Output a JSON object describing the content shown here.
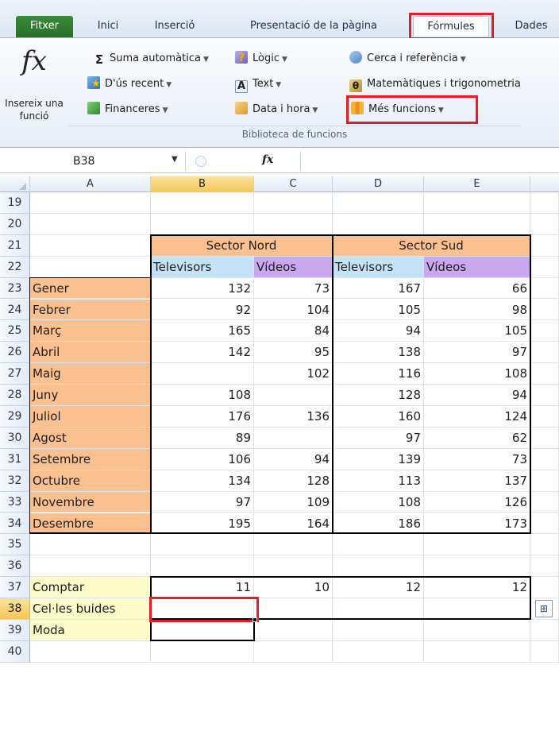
{
  "tabs": [
    "Fitxer",
    "Inici",
    "Inserció",
    "Presentació de la pàgina",
    "Fórmules",
    "Dades"
  ],
  "ribbon": {
    "insert_function": "Insereix una funció",
    "autosum": "Suma automàtica",
    "recent": "D'ús recent",
    "financial": "Financeres",
    "logical": "Lògic",
    "text": "Text",
    "datetime": "Data i hora",
    "lookup": "Cerca i referència",
    "math": "Matemàtiques i trigonometria",
    "more": "Més funcions",
    "group_label": "Biblioteca de funcions",
    "fx_symbol": "fx"
  },
  "formula_bar": {
    "name_box": "B38",
    "fx_symbol": "fx",
    "value": ""
  },
  "columns": [
    "A",
    "B",
    "C",
    "D",
    "E"
  ],
  "selected_column": "B",
  "selected_row": 38,
  "table": {
    "sector_nord": "Sector Nord",
    "sector_sud": "Sector Sud",
    "subheaders": [
      "Televisors",
      "Vídeos",
      "Televisors",
      "Vídeos"
    ],
    "months": [
      {
        "name": "Gener",
        "values": [
          "132",
          "73",
          "167",
          "66"
        ]
      },
      {
        "name": "Febrer",
        "values": [
          "92",
          "104",
          "105",
          "98"
        ]
      },
      {
        "name": "Març",
        "values": [
          "165",
          "84",
          "94",
          "105"
        ]
      },
      {
        "name": "Abril",
        "values": [
          "142",
          "95",
          "138",
          "97"
        ]
      },
      {
        "name": "Maig",
        "values": [
          "",
          "102",
          "116",
          "108"
        ]
      },
      {
        "name": "Juny",
        "values": [
          "108",
          "",
          "128",
          "94"
        ]
      },
      {
        "name": "Juliol",
        "values": [
          "176",
          "136",
          "160",
          "124"
        ]
      },
      {
        "name": "Agost",
        "values": [
          "89",
          "",
          "97",
          "62"
        ]
      },
      {
        "name": "Setembre",
        "values": [
          "106",
          "94",
          "139",
          "73"
        ]
      },
      {
        "name": "Octubre",
        "values": [
          "134",
          "128",
          "113",
          "137"
        ]
      },
      {
        "name": "Novembre",
        "values": [
          "97",
          "109",
          "108",
          "126"
        ]
      },
      {
        "name": "Desembre",
        "values": [
          "195",
          "164",
          "186",
          "173"
        ]
      }
    ],
    "stats": [
      {
        "label": "Comptar",
        "values": [
          "11",
          "10",
          "12",
          "12"
        ]
      },
      {
        "label": "Cel·les buides",
        "values": [
          "",
          "",
          "",
          ""
        ]
      },
      {
        "label": "Moda",
        "values": [
          ""
        ]
      }
    ]
  }
}
